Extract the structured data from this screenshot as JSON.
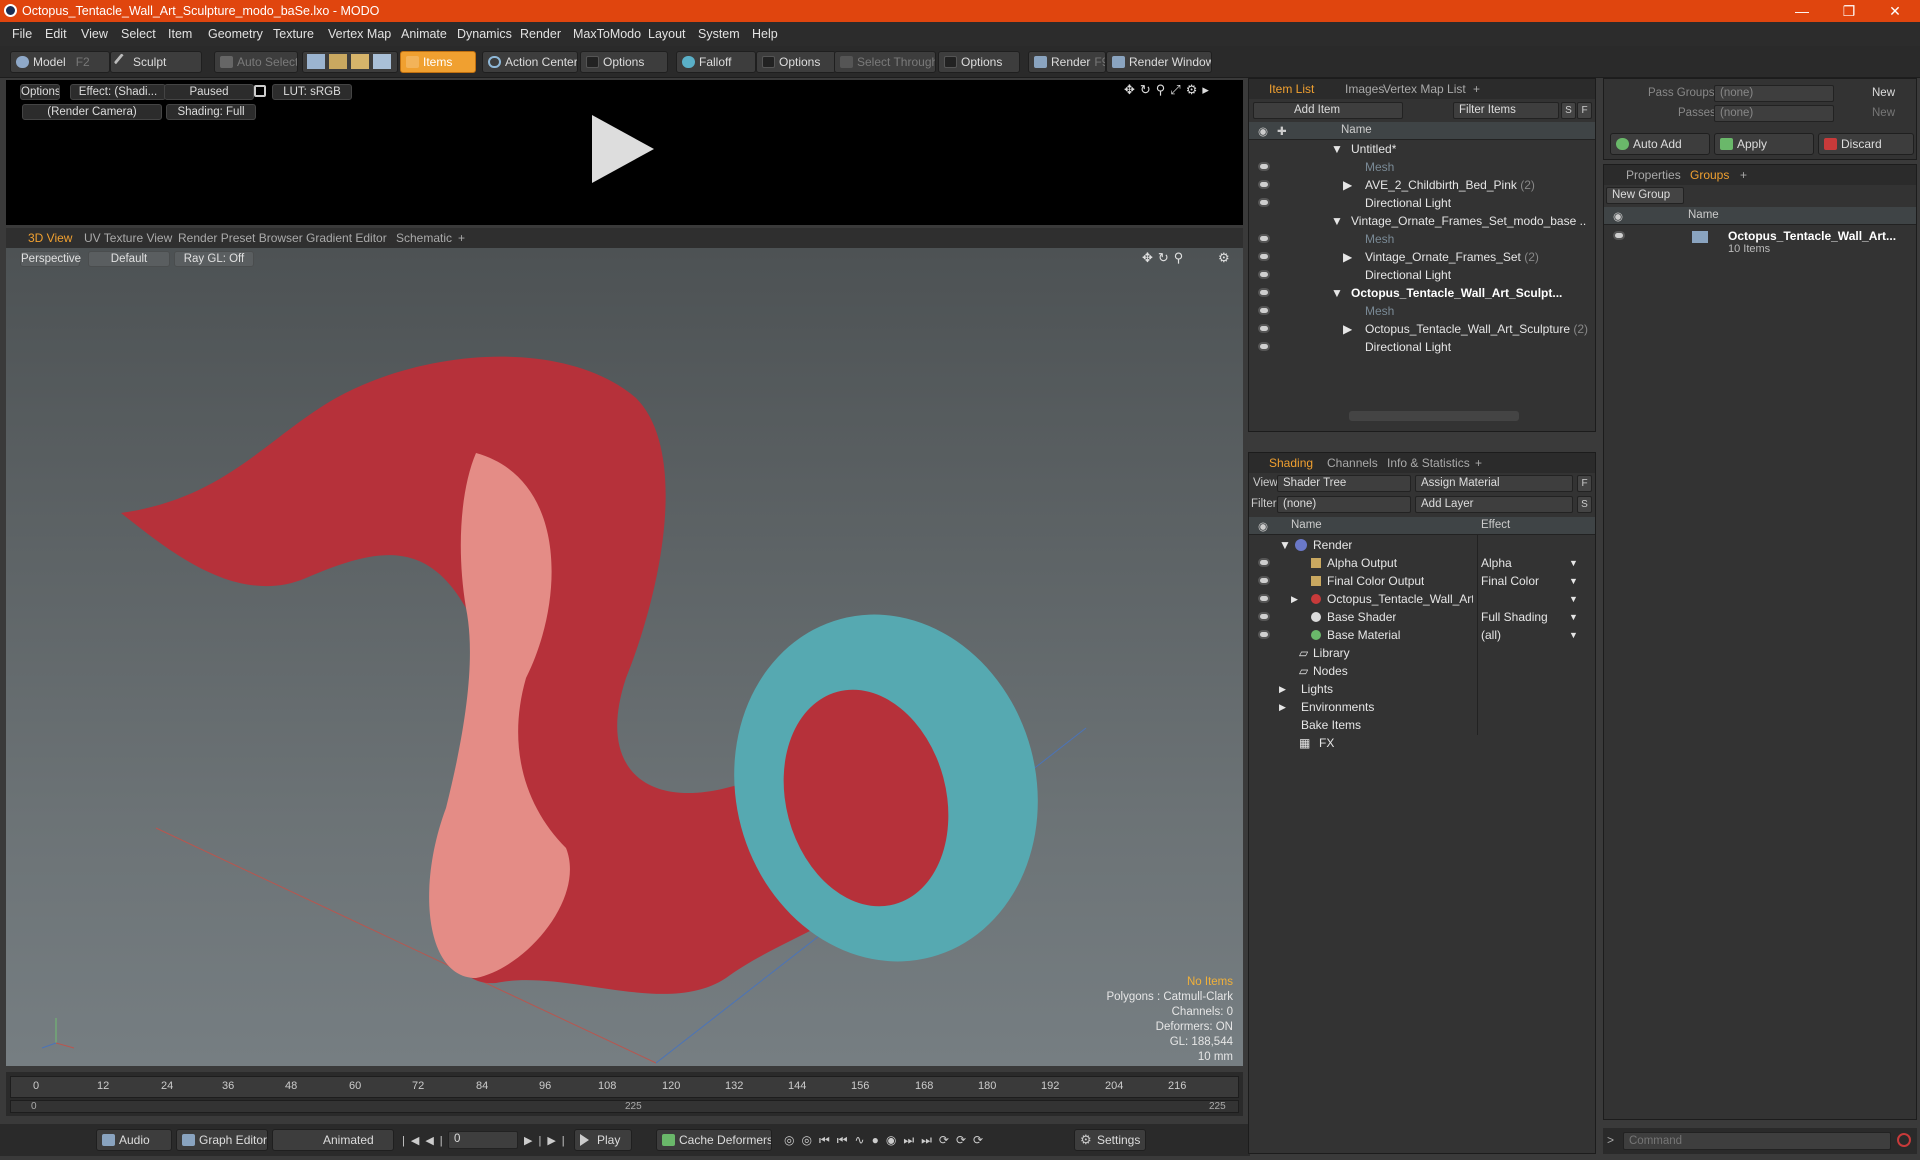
{
  "window": {
    "title": "Octopus_Tentacle_Wall_Art_Sculpture_modo_baSe.lxo - MODO"
  },
  "menu": [
    "File",
    "Edit",
    "View",
    "Select",
    "Item",
    "Geometry",
    "Texture",
    "Vertex Map",
    "Animate",
    "Dynamics",
    "Render",
    "MaxToModo",
    "Layout",
    "System",
    "Help"
  ],
  "toolbar": {
    "model": "Model",
    "model_key": "F2",
    "sculpt": "Sculpt",
    "auto_select": "Auto Select",
    "items": "Items",
    "action_center": "Action Center",
    "options1": "Options",
    "falloff": "Falloff",
    "options2": "Options",
    "select_through": "Select Through",
    "options3": "Options",
    "render": "Render",
    "render_key": "F9",
    "render_window": "Render Window"
  },
  "render_panel": {
    "options": "Options",
    "effect": "Effect: (Shadi...",
    "paused": "Paused",
    "lut": "LUT: sRGB",
    "camera": "(Render Camera)",
    "shading": "Shading: Full"
  },
  "viewport_tabs": [
    "3D View",
    "UV Texture View",
    "Render Preset Browser",
    "Gradient Editor",
    "Schematic",
    "+"
  ],
  "viewport": {
    "perspective": "Perspective",
    "default": "Default",
    "raygl": "Ray GL: Off",
    "info": [
      "No Items",
      "Polygons : Catmull-Clark",
      "Channels: 0",
      "Deformers: ON",
      "GL: 188,544",
      "10 mm"
    ]
  },
  "timeline": {
    "ticks": [
      "0",
      "12",
      "24",
      "36",
      "48",
      "60",
      "72",
      "84",
      "96",
      "108",
      "120",
      "132",
      "144",
      "156",
      "168",
      "180",
      "192",
      "204",
      "216"
    ],
    "lower": [
      "0",
      "225",
      "225"
    ]
  },
  "bottombar": {
    "audio": "Audio",
    "graph_editor": "Graph Editor",
    "animated": "Animated",
    "frame": "0",
    "play": "Play",
    "cache": "Cache Deformers",
    "settings": "Settings"
  },
  "item_list": {
    "tabs": [
      "Item List",
      "Images",
      "Vertex Map List",
      "+"
    ],
    "add_item": "Add Item",
    "filter": "Filter Items",
    "s": "S",
    "f": "F",
    "name_header": "Name",
    "rows": [
      {
        "label": "Untitled*",
        "count": ""
      },
      {
        "label": "Mesh",
        "count": ""
      },
      {
        "label": "AVE_2_Childbirth_Bed_Pink",
        "count": "(2)"
      },
      {
        "label": "Directional Light",
        "count": ""
      },
      {
        "label": "Vintage_Ornate_Frames_Set_modo_base ...",
        "count": ""
      },
      {
        "label": "Mesh",
        "count": ""
      },
      {
        "label": "Vintage_Ornate_Frames_Set",
        "count": "(2)"
      },
      {
        "label": "Directional Light",
        "count": ""
      },
      {
        "label": "Octopus_Tentacle_Wall_Art_Sculpt...",
        "count": ""
      },
      {
        "label": "Mesh",
        "count": ""
      },
      {
        "label": "Octopus_Tentacle_Wall_Art_Sculpture",
        "count": "(2)"
      },
      {
        "label": "Directional Light",
        "count": ""
      }
    ]
  },
  "shading": {
    "tabs": [
      "Shading",
      "Channels",
      "Info & Statistics",
      "+"
    ],
    "view_label": "View",
    "view_value": "Shader Tree",
    "assign": "Assign Material",
    "f": "F",
    "filter_label": "Filter",
    "filter_value": "(none)",
    "add_layer": "Add Layer",
    "s": "S",
    "name_header": "Name",
    "effect_header": "Effect",
    "rows": [
      {
        "label": "Render",
        "effect": ""
      },
      {
        "label": "Alpha Output",
        "effect": "Alpha"
      },
      {
        "label": "Final Color Output",
        "effect": "Final Color"
      },
      {
        "label": "Octopus_Tentacle_Wall_Art...",
        "effect": ""
      },
      {
        "label": "Base Shader",
        "effect": "Full Shading"
      },
      {
        "label": "Base Material",
        "effect": "(all)"
      },
      {
        "label": "Library",
        "effect": ""
      },
      {
        "label": "Nodes",
        "effect": ""
      },
      {
        "label": "Lights",
        "effect": ""
      },
      {
        "label": "Environments",
        "effect": ""
      },
      {
        "label": "Bake Items",
        "effect": ""
      },
      {
        "label": "FX",
        "effect": ""
      }
    ]
  },
  "pass": {
    "pass_groups": "Pass Groups",
    "passes": "Passes",
    "none1": "(none)",
    "none2": "(none)",
    "new1": "New",
    "new2": "New",
    "auto_add": "Auto Add",
    "apply": "Apply",
    "discard": "Discard"
  },
  "groups": {
    "tabs": [
      "Properties",
      "Groups",
      "+"
    ],
    "new_group": "New Group",
    "name_header": "Name",
    "group_name": "Octopus_Tentacle_Wall_Art...",
    "group_count": "10 Items"
  },
  "command": {
    "placeholder": "Command"
  }
}
